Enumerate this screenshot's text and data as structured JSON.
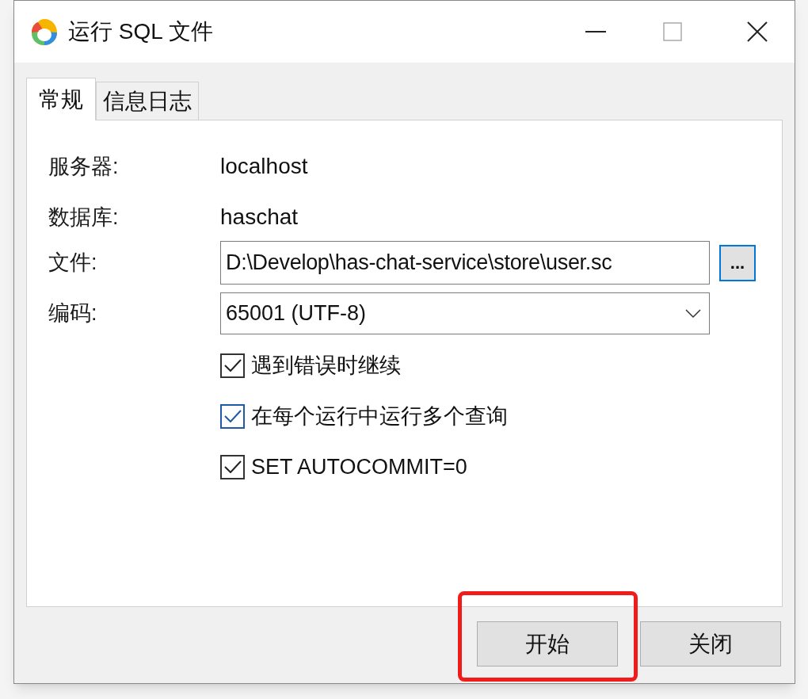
{
  "window": {
    "title": "运行 SQL 文件"
  },
  "tabs": [
    {
      "label": "常规",
      "selected": true
    },
    {
      "label": "信息日志",
      "selected": false
    }
  ],
  "form": {
    "server_label": "服务器:",
    "server": "localhost",
    "database_label": "数据库:",
    "database": "haschat",
    "file_label": "文件:",
    "file_value": "D:\\Develop\\has-chat-service\\store\\user.sc",
    "browse_button": "...",
    "browse_focused": true,
    "encoding_label": "编码:",
    "encoding": "65001 (UTF-8)"
  },
  "options": [
    {
      "label": "遇到错误时继续",
      "checked": true,
      "focused": false
    },
    {
      "label": "在每个运行中运行多个查询",
      "checked": true,
      "focused": true
    },
    {
      "label": "SET AUTOCOMMIT=0",
      "checked": true,
      "focused": false
    }
  ],
  "buttons": [
    {
      "label": "开始",
      "highlighted": true
    },
    {
      "label": "关闭",
      "highlighted": false
    }
  ]
}
